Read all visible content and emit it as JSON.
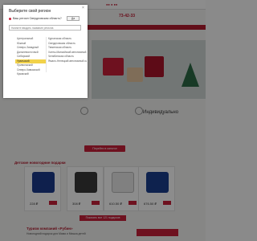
{
  "modal": {
    "title": "Выберите свой регион",
    "question": "Ваш регион Свердловская область?",
    "yes_label": "Да",
    "search_placeholder": "Начните вводить название региона",
    "federal_districts": [
      {
        "label": "Центральный",
        "active": false
      },
      {
        "label": "Южный",
        "active": false
      },
      {
        "label": "Северо-Западный",
        "active": false
      },
      {
        "label": "Дальневосточный",
        "active": false
      },
      {
        "label": "Сибирский",
        "active": false
      },
      {
        "label": "Уральский",
        "active": true
      },
      {
        "label": "Приволжский",
        "active": false
      },
      {
        "label": "Северо-Кавказский",
        "active": false
      },
      {
        "label": "Крымский",
        "active": false
      }
    ],
    "regions": [
      "Курганская область",
      "Свердловская область",
      "Тюменская область",
      "Ханты-Мансийский автономный округ",
      "Челябинская область",
      "Ямало-Ненецкий автономный округ"
    ]
  },
  "background": {
    "phone": "73-42-33",
    "individual_title": "Индивидуально",
    "cta_label": "Перейти в каталог",
    "products_title": "Детские новогодние подарки",
    "prices": [
      "228 ₽",
      "308 ₽",
      "610.50 ₽",
      "676.50 ₽"
    ],
    "all_products_label": "Показать все 121 подарков",
    "bottom_title": "Туризм компаний «Рубин»",
    "bottom_subtitle": "Новогодний подарок для Мама и Мишка детей"
  },
  "colors": {
    "accent": "#c8203a",
    "active_district": "#f2d24a",
    "overlay": "#000000"
  }
}
